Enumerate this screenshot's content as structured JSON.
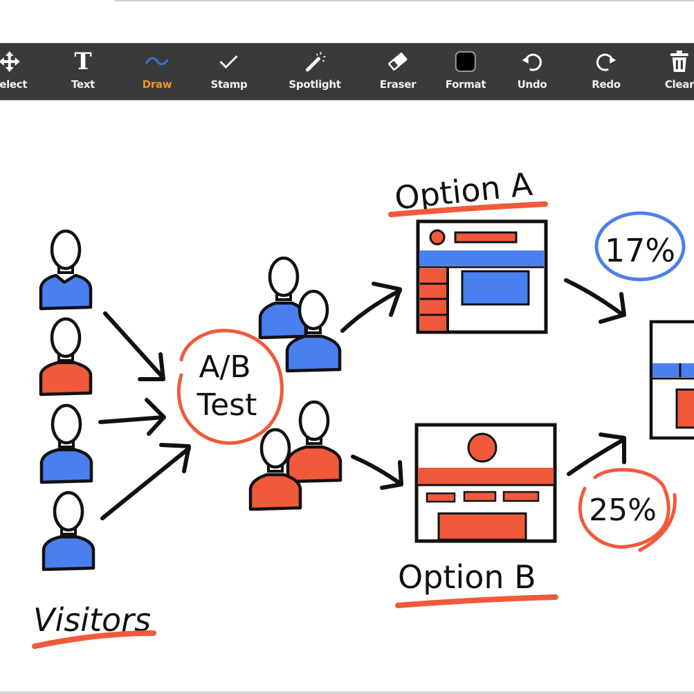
{
  "toolbar": {
    "items": [
      {
        "id": "select",
        "label": "Select",
        "icon": "move-arrows-icon",
        "active": false
      },
      {
        "id": "text",
        "label": "Text",
        "icon": "text-t-icon",
        "active": false
      },
      {
        "id": "draw",
        "label": "Draw",
        "icon": "squiggle-line-icon",
        "active": true
      },
      {
        "id": "stamp",
        "label": "Stamp",
        "icon": "checkmark-icon",
        "active": false
      },
      {
        "id": "spotlight",
        "label": "Spotlight",
        "icon": "magic-wand-icon",
        "active": false
      },
      {
        "id": "eraser",
        "label": "Eraser",
        "icon": "eraser-icon",
        "active": false
      },
      {
        "id": "format",
        "label": "Format",
        "icon": "color-swatch-icon",
        "active": false
      },
      {
        "id": "undo",
        "label": "Undo",
        "icon": "undo-icon",
        "active": false
      },
      {
        "id": "redo",
        "label": "Redo",
        "icon": "redo-icon",
        "active": false
      },
      {
        "id": "clear",
        "label": "Clear",
        "icon": "trash-icon",
        "active": false
      }
    ],
    "active_color": "#f7931e",
    "draw_icon_color": "#3a6fe0",
    "format_swatch_color": "#000000"
  },
  "whiteboard": {
    "ab_test_line1": "A/B",
    "ab_test_line2": "Test",
    "option_a_label": "Option A",
    "option_b_label": "Option B",
    "visitors_label": "Visitors",
    "option_a_rate": "17%",
    "option_b_rate": "25%",
    "colors": {
      "blue": "#4a7ff0",
      "red": "#f05a3a",
      "ink": "#111111"
    }
  }
}
